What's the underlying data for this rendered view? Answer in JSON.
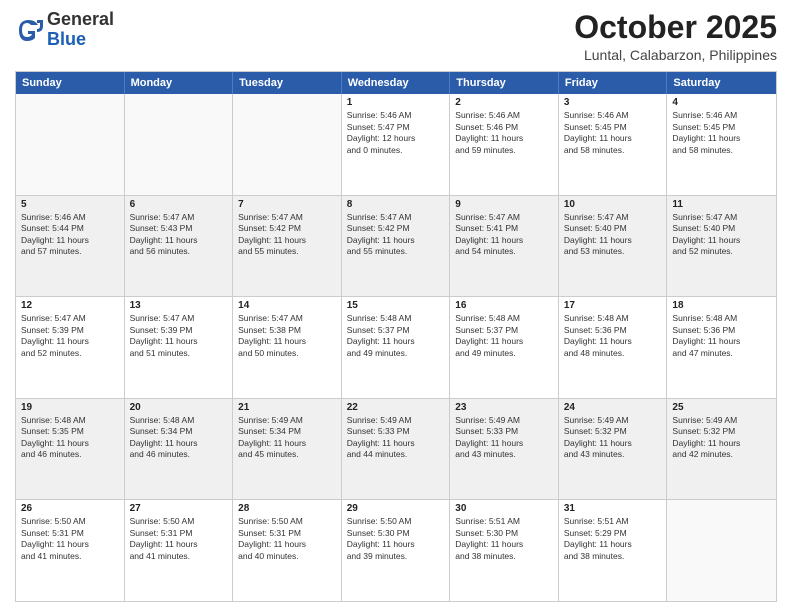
{
  "header": {
    "logo_general": "General",
    "logo_blue": "Blue",
    "month_title": "October 2025",
    "location": "Luntal, Calabarzon, Philippines"
  },
  "days_of_week": [
    "Sunday",
    "Monday",
    "Tuesday",
    "Wednesday",
    "Thursday",
    "Friday",
    "Saturday"
  ],
  "rows": [
    [
      {
        "day": "",
        "info": ""
      },
      {
        "day": "",
        "info": ""
      },
      {
        "day": "",
        "info": ""
      },
      {
        "day": "1",
        "info": "Sunrise: 5:46 AM\nSunset: 5:47 PM\nDaylight: 12 hours\nand 0 minutes."
      },
      {
        "day": "2",
        "info": "Sunrise: 5:46 AM\nSunset: 5:46 PM\nDaylight: 11 hours\nand 59 minutes."
      },
      {
        "day": "3",
        "info": "Sunrise: 5:46 AM\nSunset: 5:45 PM\nDaylight: 11 hours\nand 58 minutes."
      },
      {
        "day": "4",
        "info": "Sunrise: 5:46 AM\nSunset: 5:45 PM\nDaylight: 11 hours\nand 58 minutes."
      }
    ],
    [
      {
        "day": "5",
        "info": "Sunrise: 5:46 AM\nSunset: 5:44 PM\nDaylight: 11 hours\nand 57 minutes."
      },
      {
        "day": "6",
        "info": "Sunrise: 5:47 AM\nSunset: 5:43 PM\nDaylight: 11 hours\nand 56 minutes."
      },
      {
        "day": "7",
        "info": "Sunrise: 5:47 AM\nSunset: 5:42 PM\nDaylight: 11 hours\nand 55 minutes."
      },
      {
        "day": "8",
        "info": "Sunrise: 5:47 AM\nSunset: 5:42 PM\nDaylight: 11 hours\nand 55 minutes."
      },
      {
        "day": "9",
        "info": "Sunrise: 5:47 AM\nSunset: 5:41 PM\nDaylight: 11 hours\nand 54 minutes."
      },
      {
        "day": "10",
        "info": "Sunrise: 5:47 AM\nSunset: 5:40 PM\nDaylight: 11 hours\nand 53 minutes."
      },
      {
        "day": "11",
        "info": "Sunrise: 5:47 AM\nSunset: 5:40 PM\nDaylight: 11 hours\nand 52 minutes."
      }
    ],
    [
      {
        "day": "12",
        "info": "Sunrise: 5:47 AM\nSunset: 5:39 PM\nDaylight: 11 hours\nand 52 minutes."
      },
      {
        "day": "13",
        "info": "Sunrise: 5:47 AM\nSunset: 5:39 PM\nDaylight: 11 hours\nand 51 minutes."
      },
      {
        "day": "14",
        "info": "Sunrise: 5:47 AM\nSunset: 5:38 PM\nDaylight: 11 hours\nand 50 minutes."
      },
      {
        "day": "15",
        "info": "Sunrise: 5:48 AM\nSunset: 5:37 PM\nDaylight: 11 hours\nand 49 minutes."
      },
      {
        "day": "16",
        "info": "Sunrise: 5:48 AM\nSunset: 5:37 PM\nDaylight: 11 hours\nand 49 minutes."
      },
      {
        "day": "17",
        "info": "Sunrise: 5:48 AM\nSunset: 5:36 PM\nDaylight: 11 hours\nand 48 minutes."
      },
      {
        "day": "18",
        "info": "Sunrise: 5:48 AM\nSunset: 5:36 PM\nDaylight: 11 hours\nand 47 minutes."
      }
    ],
    [
      {
        "day": "19",
        "info": "Sunrise: 5:48 AM\nSunset: 5:35 PM\nDaylight: 11 hours\nand 46 minutes."
      },
      {
        "day": "20",
        "info": "Sunrise: 5:48 AM\nSunset: 5:34 PM\nDaylight: 11 hours\nand 46 minutes."
      },
      {
        "day": "21",
        "info": "Sunrise: 5:49 AM\nSunset: 5:34 PM\nDaylight: 11 hours\nand 45 minutes."
      },
      {
        "day": "22",
        "info": "Sunrise: 5:49 AM\nSunset: 5:33 PM\nDaylight: 11 hours\nand 44 minutes."
      },
      {
        "day": "23",
        "info": "Sunrise: 5:49 AM\nSunset: 5:33 PM\nDaylight: 11 hours\nand 43 minutes."
      },
      {
        "day": "24",
        "info": "Sunrise: 5:49 AM\nSunset: 5:32 PM\nDaylight: 11 hours\nand 43 minutes."
      },
      {
        "day": "25",
        "info": "Sunrise: 5:49 AM\nSunset: 5:32 PM\nDaylight: 11 hours\nand 42 minutes."
      }
    ],
    [
      {
        "day": "26",
        "info": "Sunrise: 5:50 AM\nSunset: 5:31 PM\nDaylight: 11 hours\nand 41 minutes."
      },
      {
        "day": "27",
        "info": "Sunrise: 5:50 AM\nSunset: 5:31 PM\nDaylight: 11 hours\nand 41 minutes."
      },
      {
        "day": "28",
        "info": "Sunrise: 5:50 AM\nSunset: 5:31 PM\nDaylight: 11 hours\nand 40 minutes."
      },
      {
        "day": "29",
        "info": "Sunrise: 5:50 AM\nSunset: 5:30 PM\nDaylight: 11 hours\nand 39 minutes."
      },
      {
        "day": "30",
        "info": "Sunrise: 5:51 AM\nSunset: 5:30 PM\nDaylight: 11 hours\nand 38 minutes."
      },
      {
        "day": "31",
        "info": "Sunrise: 5:51 AM\nSunset: 5:29 PM\nDaylight: 11 hours\nand 38 minutes."
      },
      {
        "day": "",
        "info": ""
      }
    ]
  ]
}
